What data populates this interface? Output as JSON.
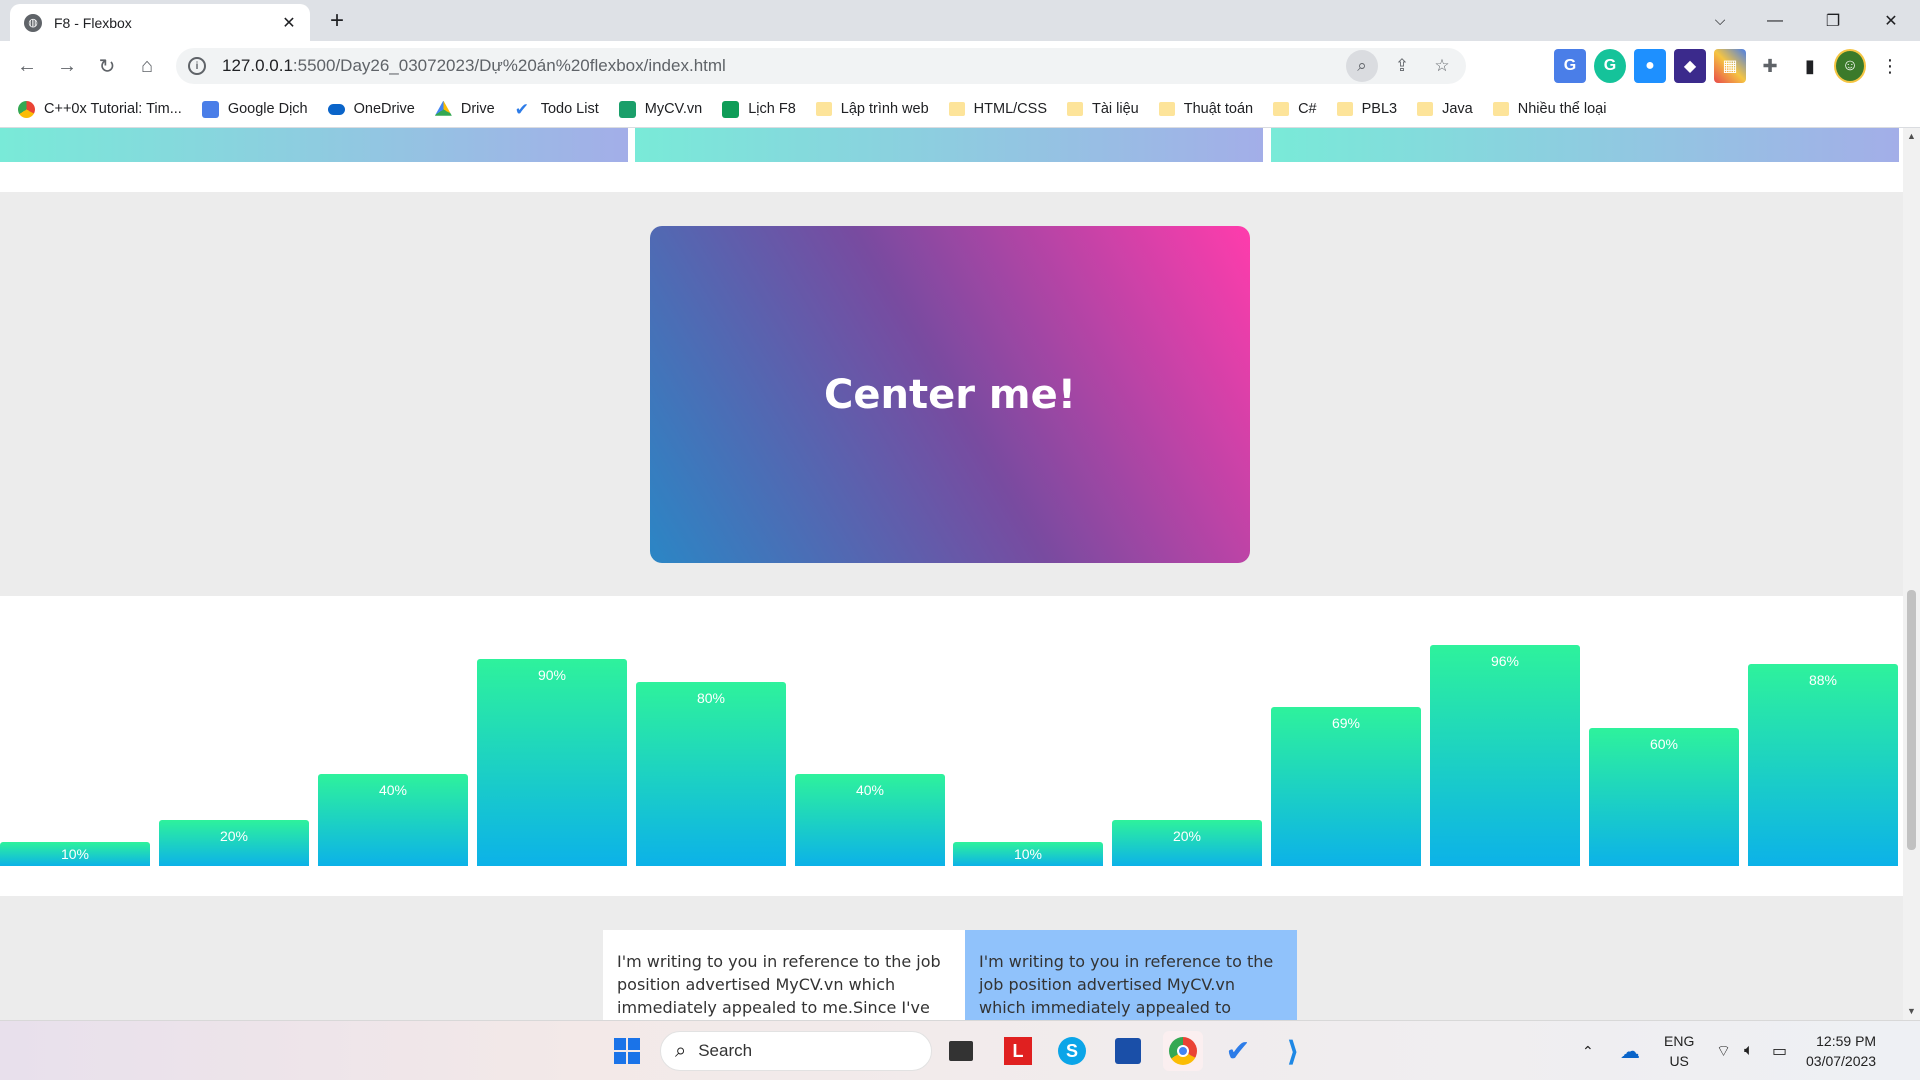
{
  "browser": {
    "tab_title": "F8 - Flexbox",
    "url_host": "127.0.0.1",
    "url_rest": ":5500/Day26_03072023/Dự%20án%20flexbox/index.html",
    "bookmarks": [
      {
        "label": "C++0x Tutorial: Tim...",
        "icon": "chrome-icon",
        "color": "#e8a33a"
      },
      {
        "label": "Google Dịch",
        "icon": "translate-icon",
        "color": "#4a7ee8"
      },
      {
        "label": "OneDrive",
        "icon": "cloud-icon",
        "color": "#0a64c9"
      },
      {
        "label": "Drive",
        "icon": "drive-icon",
        "color": "#34a853"
      },
      {
        "label": "Todo List",
        "icon": "check-icon",
        "color": "#2d7ce8"
      },
      {
        "label": "MyCV.vn",
        "icon": "mycv-icon",
        "color": "#1a9f6a"
      },
      {
        "label": "Lịch F8",
        "icon": "calendar-icon",
        "color": "#0f9d58"
      },
      {
        "label": "Lập trình web",
        "icon": "folder-icon",
        "color": "#fde49a"
      },
      {
        "label": "HTML/CSS",
        "icon": "folder-icon",
        "color": "#fde49a"
      },
      {
        "label": "Tài liệu",
        "icon": "folder-icon",
        "color": "#fde49a"
      },
      {
        "label": "Thuật toán",
        "icon": "folder-icon",
        "color": "#fde49a"
      },
      {
        "label": "C#",
        "icon": "folder-icon",
        "color": "#fde49a"
      },
      {
        "label": "PBL3",
        "icon": "folder-icon",
        "color": "#fde49a"
      },
      {
        "label": "Java",
        "icon": "folder-icon",
        "color": "#fde49a"
      },
      {
        "label": "Nhiều thể loại",
        "icon": "folder-icon",
        "color": "#fde49a"
      }
    ]
  },
  "page": {
    "center_text": "Center me!",
    "bars": [
      "10%",
      "20%",
      "40%",
      "90%",
      "80%",
      "40%",
      "10%",
      "20%",
      "69%",
      "96%",
      "60%",
      "88%"
    ],
    "bar_values": [
      0.1,
      0.2,
      0.4,
      0.9,
      0.8,
      0.4,
      0.1,
      0.2,
      0.69,
      0.96,
      0.6,
      0.88
    ],
    "paragraph_1": "I'm writing to you in reference to the job position advertised MyCV.vn which immediately appealed to me.Since I've",
    "paragraph_2": "I'm writing to you in reference to the job position advertised MyCV.vn which immediately appealed to me.Since I've"
  },
  "taskbar": {
    "search_label": "Search",
    "lang_top": "ENG",
    "lang_bottom": "US",
    "time": "12:59 PM",
    "date": "03/07/2023"
  }
}
